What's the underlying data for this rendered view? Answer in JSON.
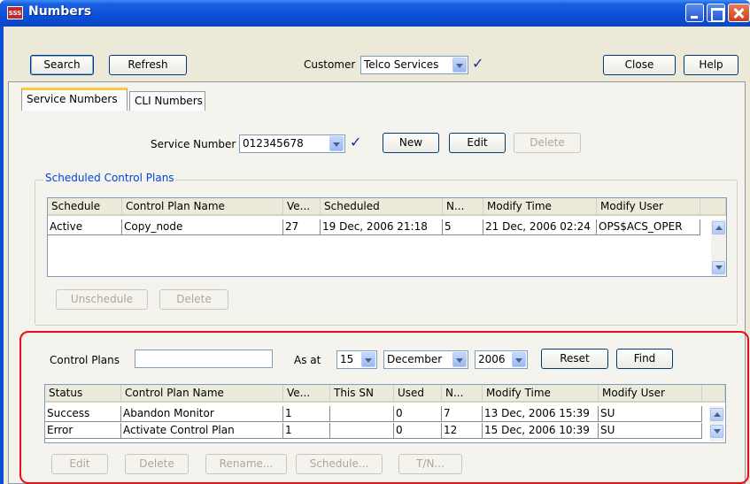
{
  "window": {
    "title": "Numbers",
    "app_icon_text": "SSS"
  },
  "toolbar": {
    "search_label": "Search",
    "refresh_label": "Refresh",
    "customer_label": "Customer",
    "customer_value": "Telco Services",
    "close_label": "Close",
    "help_label": "Help"
  },
  "tabs": [
    {
      "label": "Service Numbers",
      "active": true
    },
    {
      "label": "CLI Numbers",
      "active": false
    }
  ],
  "service_number": {
    "label": "Service Number",
    "value": "012345678",
    "new_label": "New",
    "edit_label": "Edit",
    "delete_label": "Delete"
  },
  "scheduled": {
    "title": "Scheduled Control Plans",
    "columns": [
      "Schedule",
      "Control Plan Name",
      "Ve...",
      "Scheduled",
      "N...",
      "Modify Time",
      "Modify User"
    ],
    "rows": [
      [
        "Active",
        "Copy_node",
        "27",
        "19 Dec, 2006 21:18",
        "5",
        "21 Dec, 2006 02:24",
        "OPS$ACS_OPER"
      ]
    ],
    "unschedule_label": "Unschedule",
    "delete_label": "Delete"
  },
  "control_plans": {
    "label": "Control Plans",
    "filter_value": "",
    "as_at_label": "As at",
    "day": "15",
    "month": "December",
    "year": "2006",
    "reset_label": "Reset",
    "find_label": "Find",
    "columns": [
      "Status",
      "Control Plan Name",
      "Ve...",
      "This SN",
      "Used",
      "N...",
      "Modify Time",
      "Modify User"
    ],
    "rows": [
      [
        "Success",
        "Abandon Monitor",
        "1",
        "",
        "0",
        "7",
        "13 Dec, 2006 15:39",
        "SU"
      ],
      [
        "Error",
        "Activate Control Plan",
        "1",
        "",
        "0",
        "12",
        "15 Dec, 2006 10:39",
        "SU"
      ]
    ],
    "edit_label": "Edit",
    "delete_label": "Delete",
    "rename_label": "Rename...",
    "schedule_label": "Schedule...",
    "tn_label": "T/N..."
  },
  "colors": {
    "highlight": "#e8101a",
    "titlebar": "#0a4fd6",
    "group_title": "#0046d5"
  }
}
